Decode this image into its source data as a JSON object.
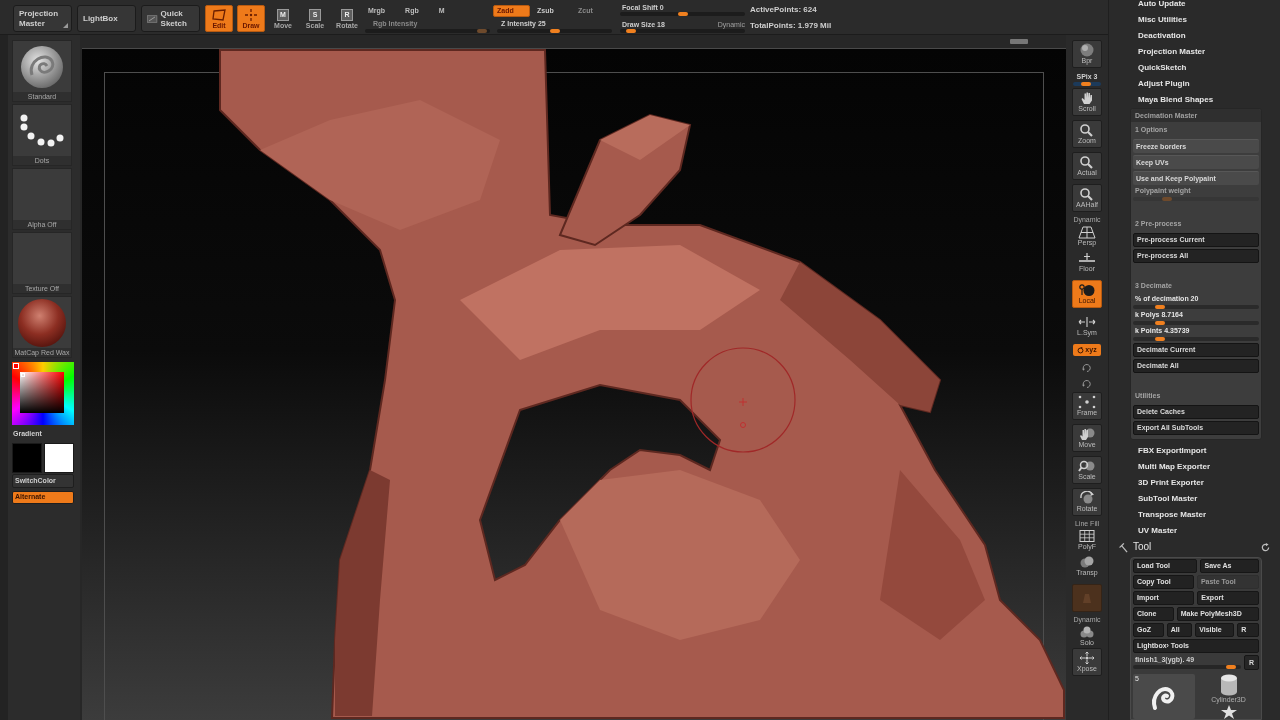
{
  "top_bar": {
    "buttons": [
      {
        "label": "Projection Master",
        "kind": "menu"
      },
      {
        "label": "LightBox",
        "kind": "plain"
      },
      {
        "label": "Quick Sketch",
        "kind": "sketch"
      }
    ],
    "modes": [
      {
        "label": "Edit",
        "kind": "quad",
        "selected": true
      },
      {
        "label": "Draw",
        "kind": "crosshair",
        "selected": true
      },
      {
        "label": "Move",
        "kind": "letter",
        "letter": "M",
        "selected": false
      },
      {
        "label": "Scale",
        "kind": "letter",
        "letter": "S",
        "selected": false
      },
      {
        "label": "Rotate",
        "kind": "letter",
        "letter": "R",
        "selected": false
      }
    ],
    "channels": [
      {
        "label": "Mrgb",
        "selected": false
      },
      {
        "label": "Rgb",
        "selected": false
      },
      {
        "label": "M",
        "selected": false
      }
    ],
    "rgb_intensity": {
      "label": "Rgb Intensity",
      "level": 0.97,
      "disabled": true
    },
    "sculpt_modes": [
      {
        "label": "Zadd",
        "selected": true,
        "disabled": false
      },
      {
        "label": "Zsub",
        "selected": false,
        "disabled": false
      },
      {
        "label": "Zcut",
        "selected": false,
        "disabled": true
      }
    ],
    "z_intensity": {
      "label": "Z Intensity 25",
      "level": 0.5
    },
    "focal_shift": {
      "label": "Focal Shift 0",
      "level": 0.5
    },
    "draw_size": {
      "label": "Draw Size 18",
      "level": 0.05,
      "mode_label": "Dynamic"
    },
    "stats": [
      "ActivePoints: 624",
      "TotalPoints: 1.979 Mil"
    ]
  },
  "left_panel": {
    "thumbnails": [
      {
        "label": "Standard",
        "kind": "brush"
      },
      {
        "label": "Dots",
        "kind": "stroke"
      },
      {
        "label": "Alpha Off",
        "kind": "empty"
      },
      {
        "label": "Texture Off",
        "kind": "empty"
      },
      {
        "label": "MatCap Red Wax",
        "kind": "material"
      }
    ],
    "gradient_label": "Gradient",
    "swatches": [
      {
        "color": "#000000"
      },
      {
        "color": "#ffffff"
      }
    ],
    "buttons": [
      {
        "label": "SwitchColor",
        "on": false
      },
      {
        "label": "Alternate",
        "on": true
      }
    ]
  },
  "right_toolbar": [
    {
      "kind": "tile",
      "label": "Bpr",
      "selected": false,
      "disabled": false
    },
    {
      "kind": "slider",
      "label": "SPix 3",
      "level": 0.45
    },
    {
      "kind": "tile",
      "label": "Scroll",
      "selected": false,
      "disabled": false
    },
    {
      "kind": "tile",
      "label": "Zoom",
      "selected": false,
      "disabled": false
    },
    {
      "kind": "tile",
      "label": "Actual",
      "selected": false,
      "disabled": false
    },
    {
      "kind": "tile",
      "label": "AAHalf",
      "selected": false,
      "disabled": false
    },
    {
      "kind": "flat",
      "caption": "Dynamic",
      "label": "Persp",
      "selected": false,
      "disabled": false
    },
    {
      "kind": "flat",
      "label": "Floor",
      "selected": false,
      "disabled": false
    },
    {
      "kind": "tile",
      "label": "Local",
      "selected": true,
      "disabled": false
    },
    {
      "kind": "flat",
      "label": "L.Sym",
      "selected": false,
      "disabled": false
    },
    {
      "kind": "toggle",
      "label": "xyz",
      "selected": true
    },
    {
      "kind": "small",
      "selected": false
    },
    {
      "kind": "small",
      "selected": false
    },
    {
      "kind": "tile",
      "label": "Frame",
      "selected": false,
      "disabled": false
    },
    {
      "kind": "tile",
      "label": "Move",
      "selected": false,
      "disabled": false
    },
    {
      "kind": "tile",
      "label": "Scale",
      "selected": false,
      "disabled": false
    },
    {
      "kind": "tile",
      "label": "Rotate",
      "selected": false,
      "disabled": false
    },
    {
      "kind": "flat",
      "caption": "Line Fill",
      "label": "PolyF",
      "selected": false,
      "disabled": false
    },
    {
      "kind": "flat",
      "label": "Transp",
      "selected": false,
      "disabled": false
    },
    {
      "kind": "tile",
      "selected": true,
      "disabled": true
    },
    {
      "kind": "flat",
      "caption": "Dynamic",
      "label": "Solo",
      "selected": false,
      "disabled": false
    },
    {
      "kind": "tile",
      "label": "Xpose",
      "selected": false,
      "disabled": false
    }
  ],
  "right_panel": {
    "plugins_top": [
      "Auto Update",
      "Misc Utilities",
      "Deactivation",
      "Projection Master",
      "QuickSketch",
      "Adjust Plugin",
      "Maya Blend Shapes"
    ],
    "decimation_master": {
      "title": "Decimation Master",
      "sections": [
        {
          "heading": "1 Options",
          "items": [
            {
              "kind": "toggle",
              "label": "Freeze borders",
              "on": false
            },
            {
              "kind": "toggle",
              "label": "Keep UVs",
              "on": false
            },
            {
              "kind": "toggle",
              "label": "Use and Keep Polypaint",
              "on": false
            },
            {
              "kind": "slider",
              "label": "Polypaint weight",
              "level": 0.25,
              "disabled": true
            }
          ]
        },
        {
          "heading": "2 Pre-process",
          "items": [
            {
              "kind": "button",
              "label": "Pre-process Current"
            },
            {
              "kind": "button",
              "label": "Pre-process All"
            }
          ]
        },
        {
          "heading": "3 Decimate",
          "items": [
            {
              "kind": "slider",
              "label": "% of decimation 20",
              "level": 0.19,
              "disabled": false
            },
            {
              "kind": "slider",
              "label": "k Polys 8.7164",
              "level": 0.19,
              "disabled": false
            },
            {
              "kind": "slider",
              "label": "k Points 4.35739",
              "level": 0.19,
              "disabled": false
            },
            {
              "kind": "button",
              "label": "Decimate Current"
            },
            {
              "kind": "button",
              "label": "Decimate All"
            }
          ]
        },
        {
          "heading": "Utilities",
          "items": [
            {
              "kind": "button",
              "label": "Delete Caches"
            },
            {
              "kind": "button",
              "label": "Export All SubTools"
            }
          ]
        }
      ]
    },
    "plugins_bottom": [
      "FBX ExportImport",
      "Multi Map Exporter",
      "3D Print Exporter",
      "SubTool Master",
      "Transpose Master",
      "UV Master"
    ],
    "tool_palette": {
      "title": "Tool",
      "rows": [
        [
          {
            "label": "Load Tool",
            "disabled": false
          },
          {
            "label": "Save As",
            "disabled": false
          }
        ],
        [
          {
            "label": "Copy Tool",
            "disabled": false
          },
          {
            "label": "Paste Tool",
            "disabled": true
          }
        ],
        [
          {
            "label": "Import",
            "disabled": false
          },
          {
            "label": "Export",
            "disabled": false
          }
        ],
        [
          {
            "label": "Clone",
            "disabled": false
          },
          {
            "label": "Make PolyMesh3D",
            "disabled": false
          }
        ],
        [
          {
            "label": "GoZ",
            "disabled": false
          },
          {
            "label": "All",
            "disabled": false
          },
          {
            "label": "Visible",
            "disabled": false
          },
          {
            "label": "R",
            "disabled": false
          }
        ],
        [
          {
            "label": "Lightbox› Tools",
            "disabled": false
          }
        ]
      ],
      "current_tool": {
        "label": "finish1_3(ygb). 49",
        "level": 0.95,
        "button": "R"
      },
      "thumbnails": [
        {
          "kind": "sculpt",
          "count": "5"
        },
        {
          "kind": "cylinder",
          "label": "Cylinder3D"
        },
        {
          "kind": "star"
        }
      ]
    }
  }
}
